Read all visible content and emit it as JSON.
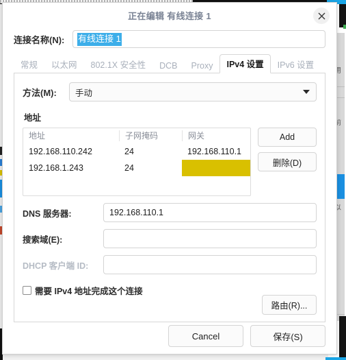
{
  "window": {
    "title": "正在编辑 有线连接 1",
    "close_icon": "close-icon"
  },
  "connection_name": {
    "label": "连接名称(N):",
    "value": "有线连接 1",
    "selected": true
  },
  "tabs": [
    {
      "label": "常规",
      "active": false
    },
    {
      "label": "以太网",
      "active": false
    },
    {
      "label": "802.1X 安全性",
      "active": false
    },
    {
      "label": "DCB",
      "active": false
    },
    {
      "label": "Proxy",
      "active": false
    },
    {
      "label": "IPv4 设置",
      "active": true
    },
    {
      "label": "IPv6 设置",
      "active": false
    }
  ],
  "method": {
    "label": "方法(M):",
    "value": "手动",
    "caret_icon": "chevron-down-icon"
  },
  "addresses": {
    "section_title": "地址",
    "columns": [
      "地址",
      "子网掩码",
      "网关"
    ],
    "rows": [
      {
        "address": "192.168.110.242",
        "netmask": "24",
        "gateway": "192.168.110.1",
        "gateway_highlighted": false
      },
      {
        "address": "192.168.1.243",
        "netmask": "24",
        "gateway": "",
        "gateway_highlighted": true
      }
    ],
    "add_label": "Add",
    "delete_label": "删除(D)",
    "highlight_color": "#d9c000"
  },
  "fields": {
    "dns": {
      "label": "DNS 服务器:",
      "value": "192.168.110.1",
      "disabled": false
    },
    "search_domains": {
      "label": "搜索域(E):",
      "value": "",
      "disabled": false
    },
    "dhcp_client_id": {
      "label": "DHCP 客户端 ID:",
      "value": "",
      "disabled": true
    }
  },
  "require_ipv4": {
    "label": "需要 IPv4 地址完成这个连接",
    "checked": false
  },
  "routes": {
    "label": "路由(R)..."
  },
  "footer": {
    "cancel_label": "Cancel",
    "save_label": "保存(S)"
  },
  "colors": {
    "accent": "#1ba7e8",
    "selection": "#3daee9",
    "highlight": "#d9c000",
    "title_text": "#7a8394"
  },
  "background": {
    "right_text_1": "用",
    "right_text_2": "前",
    "right_text_3": "以"
  }
}
